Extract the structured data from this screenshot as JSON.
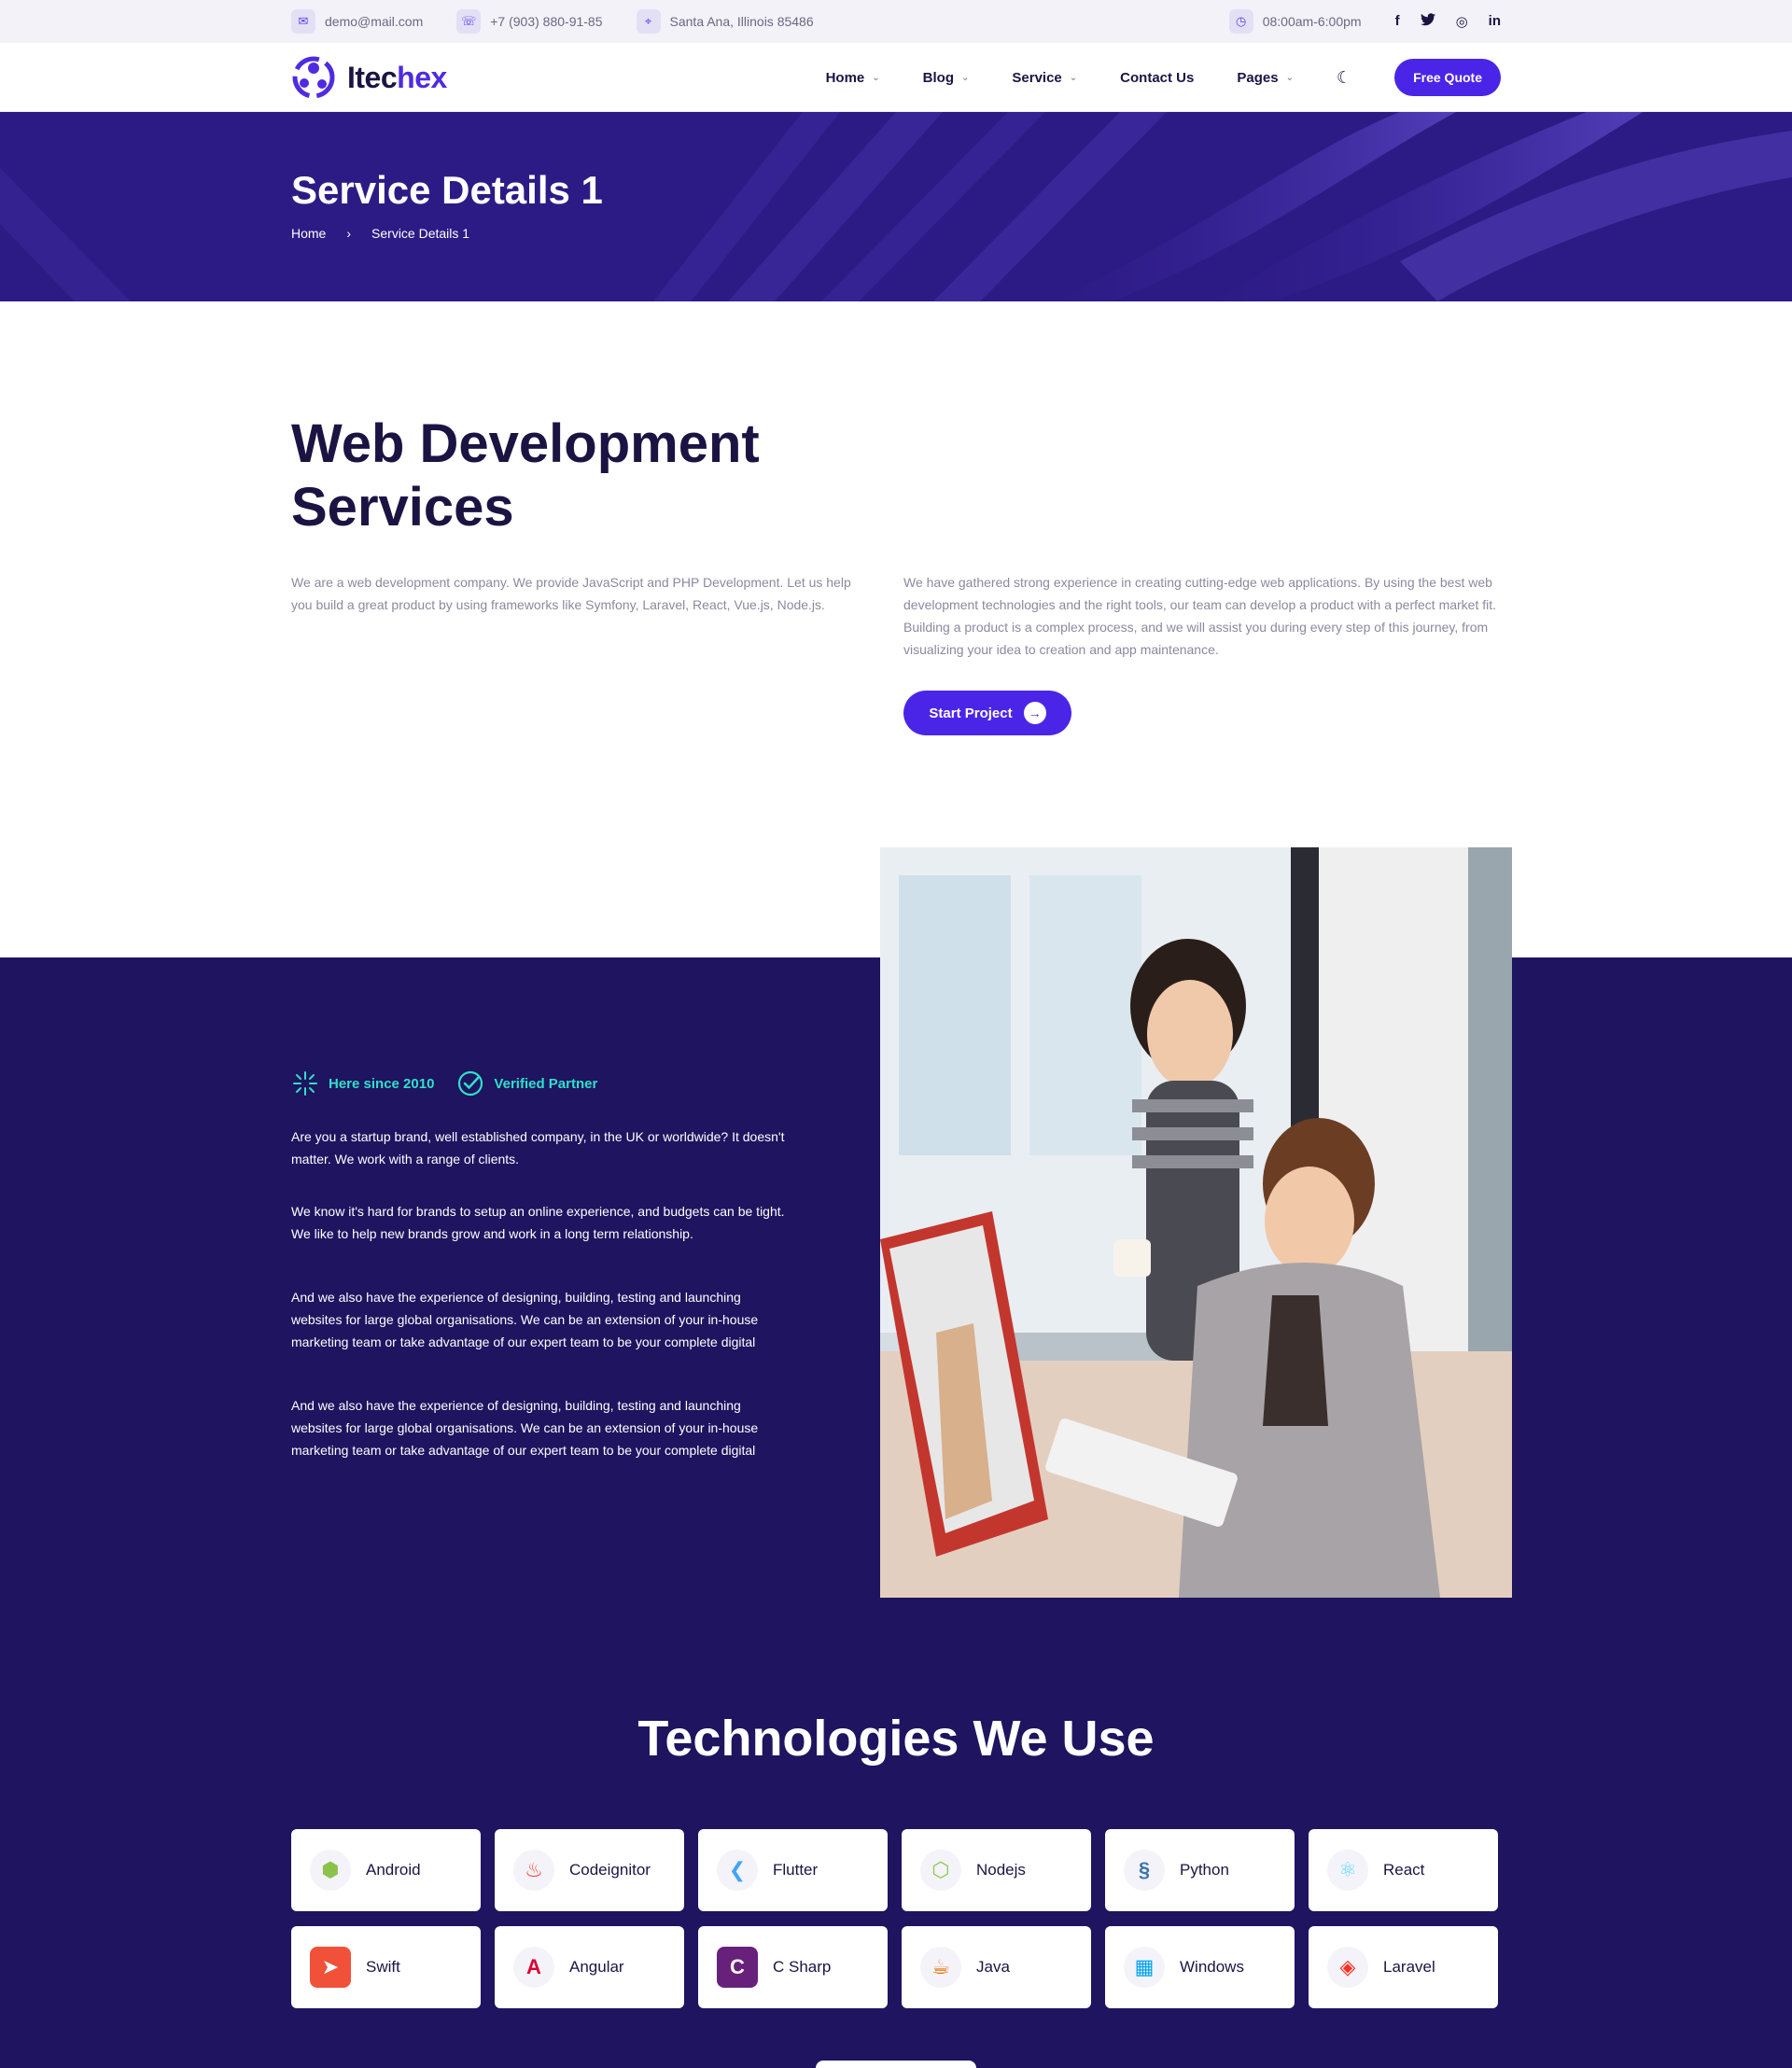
{
  "topbar": {
    "email": "demo@mail.com",
    "phone": "+7 (903) 880-91-85",
    "address": "Santa Ana, Illinois 85486",
    "hours": "08:00am-6:00pm",
    "social": {
      "facebook": "f",
      "twitter": "t",
      "instagram": "◎",
      "linkedin": "in"
    }
  },
  "header": {
    "logo_prefix": "Itec",
    "logo_accent": "hex",
    "nav": {
      "home": "Home",
      "blog": "Blog",
      "service": "Service",
      "contact": "Contact Us",
      "pages": "Pages"
    },
    "cta": "Free Quote"
  },
  "banner": {
    "title": "Service Details 1",
    "crumb_home": "Home",
    "crumb_current": "Service Details 1"
  },
  "intro": {
    "title": "Web Development Services",
    "p1": "We are a web development company. We provide JavaScript and PHP Development. Let us help you build a great product by using frameworks like Symfony, Laravel, React, Vue.js, Node.js.",
    "p2": "We have gathered strong experience in creating cutting-edge web applications. By using the best web development technologies and the right tools, our team can develop a product with a perfect market fit. Building a product is a complex process, and we will assist you during every step of this journey, from visualizing your idea to creation and app maintenance.",
    "cta": "Start Project"
  },
  "about": {
    "badge1": "Here since 2010",
    "badge2": "Verified Partner",
    "p1": "Are you a startup brand, well established company, in the UK or worldwide? It doesn't matter. We work with a range of clients.",
    "p2": "We know it's hard for brands to setup an online experience, and budgets can be tight. We like to help new brands grow and work in a long term relationship.",
    "p3": "And we also have the experience of designing, building, testing and launching websites for large global organisations. We can be an extension of your in-house marketing team or take advantage of our expert team to be your complete digital",
    "p4": "And we also have the experience of designing, building, testing and launching websites for large global organisations. We can be an extension of your in-house marketing team or take advantage of our expert team to be your complete digital"
  },
  "tech": {
    "title": "Technologies We Use",
    "items": [
      {
        "label": "Android",
        "icon": "android-icon",
        "color": "#8bc34a"
      },
      {
        "label": "Codeignitor",
        "icon": "codeigniter-icon",
        "color": "#ee4323"
      },
      {
        "label": "Flutter",
        "icon": "flutter-icon",
        "color": "#42a5f5"
      },
      {
        "label": "Nodejs",
        "icon": "nodejs-icon",
        "color": "#8cc84b"
      },
      {
        "label": "Python",
        "icon": "python-icon",
        "color": "#3776ab"
      },
      {
        "label": "React",
        "icon": "react-icon",
        "color": "#61dafb"
      },
      {
        "label": "Swift",
        "icon": "swift-icon",
        "color": "#f05138"
      },
      {
        "label": "Angular",
        "icon": "angular-icon",
        "color": "#dd0031"
      },
      {
        "label": "C Sharp",
        "icon": "csharp-icon",
        "color": "#68217a"
      },
      {
        "label": "Java",
        "icon": "java-icon",
        "color": "#e76f00"
      },
      {
        "label": "Windows",
        "icon": "windows-icon",
        "color": "#00a4ef"
      },
      {
        "label": "Laravel",
        "icon": "laravel-icon",
        "color": "#ff2d20"
      }
    ]
  },
  "colors": {
    "primary": "#4a25e8",
    "banner": "#2d1b85",
    "dark": "#1e1460",
    "accent": "#2fe0c8"
  }
}
